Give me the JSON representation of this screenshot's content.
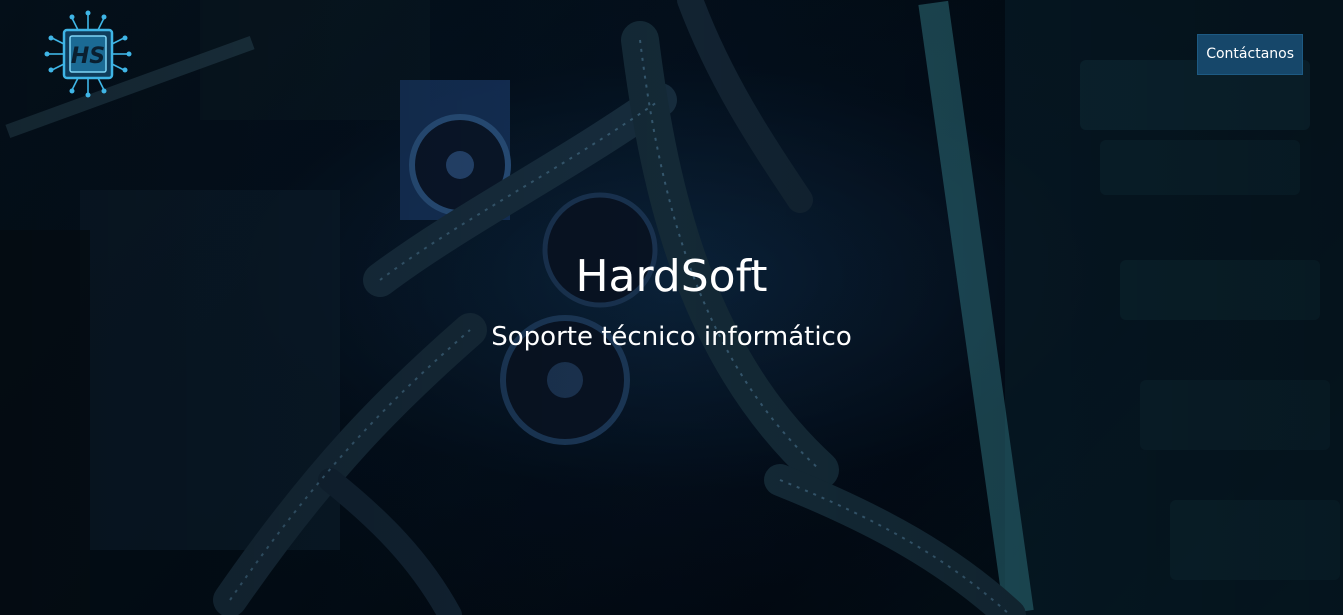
{
  "header": {
    "logo_icon": "hs-circuit-chip-logo",
    "contact_label": "Contáctanos"
  },
  "hero": {
    "title": "HardSoft",
    "subtitle": "Soporte técnico informático",
    "background_image": "computer-hardware-internals"
  },
  "colors": {
    "button_bg": "#16476a",
    "text": "#ffffff",
    "logo_accent": "#3fb5e6",
    "background": "#03101c"
  }
}
